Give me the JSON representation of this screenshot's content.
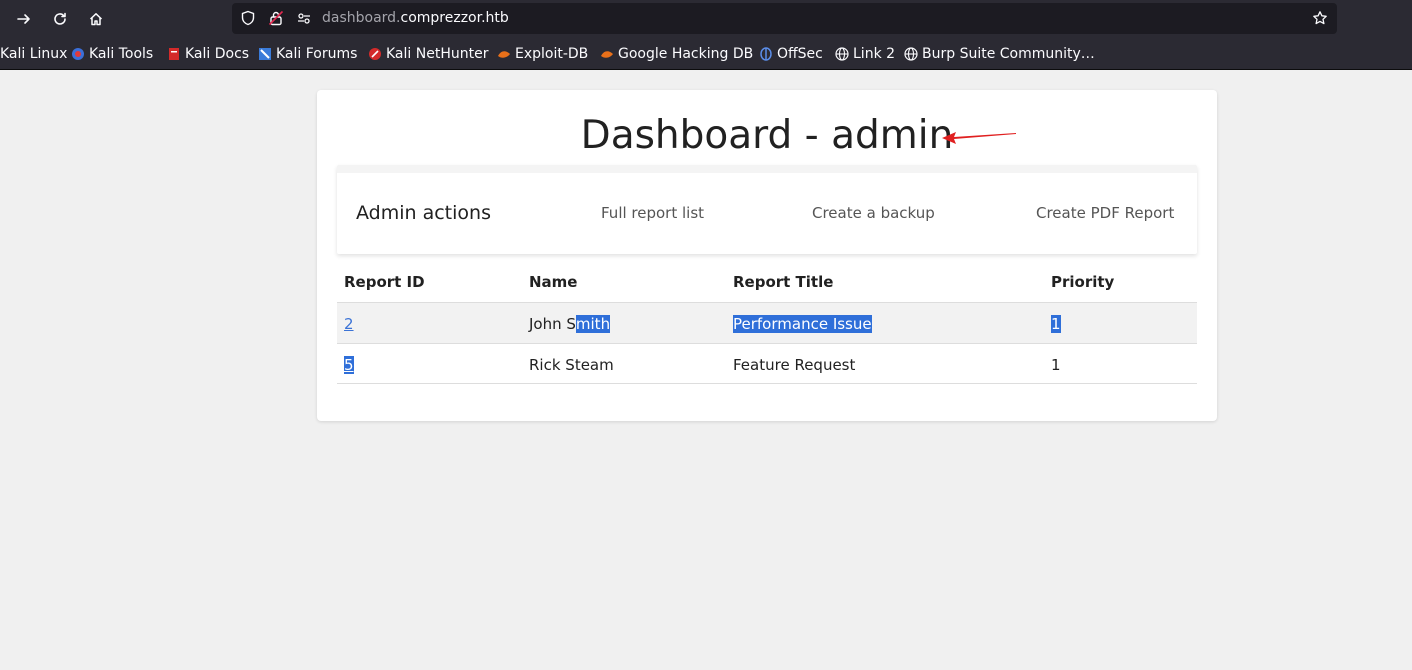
{
  "browser": {
    "url_subdomain": "dashboard.",
    "url_domain": "comprezzor.htb",
    "bookmarks": [
      {
        "label": "Kali Linux",
        "icon": "kali-icon"
      },
      {
        "label": "Kali Tools",
        "icon": "kali-tools-icon"
      },
      {
        "label": "Kali Docs",
        "icon": "kali-docs-icon"
      },
      {
        "label": "Kali Forums",
        "icon": "kali-forums-icon"
      },
      {
        "label": "Kali NetHunter",
        "icon": "nethunter-icon"
      },
      {
        "label": "Exploit-DB",
        "icon": "exploit-db-icon"
      },
      {
        "label": "Google Hacking DB",
        "icon": "ghdb-icon"
      },
      {
        "label": "OffSec",
        "icon": "offsec-icon"
      },
      {
        "label": "Link 2",
        "icon": "globe-icon"
      },
      {
        "label": "Burp Suite Community…",
        "icon": "globe-icon"
      }
    ]
  },
  "page": {
    "title": "Dashboard - admin",
    "actions_title": "Admin actions",
    "actions": [
      "Full report list",
      "Create a backup",
      "Create PDF Report"
    ],
    "table": {
      "headers": [
        "Report ID",
        "Name",
        "Report Title",
        "Priority"
      ],
      "rows": [
        {
          "id": "2",
          "name_a": "John S",
          "name_b": "mith",
          "title": "Performance Issue",
          "priority": "1"
        },
        {
          "id": "5",
          "name": "Rick Steam",
          "title": "Feature Request",
          "priority": "1"
        }
      ]
    }
  },
  "colors": {
    "chrome_bg": "#2b2a33",
    "urlbar_bg": "#1c1b22",
    "page_bg": "#f0f0f0",
    "link": "#3b73d6",
    "selection": "#2f6fd9",
    "annotation_arrow": "#e02020"
  }
}
